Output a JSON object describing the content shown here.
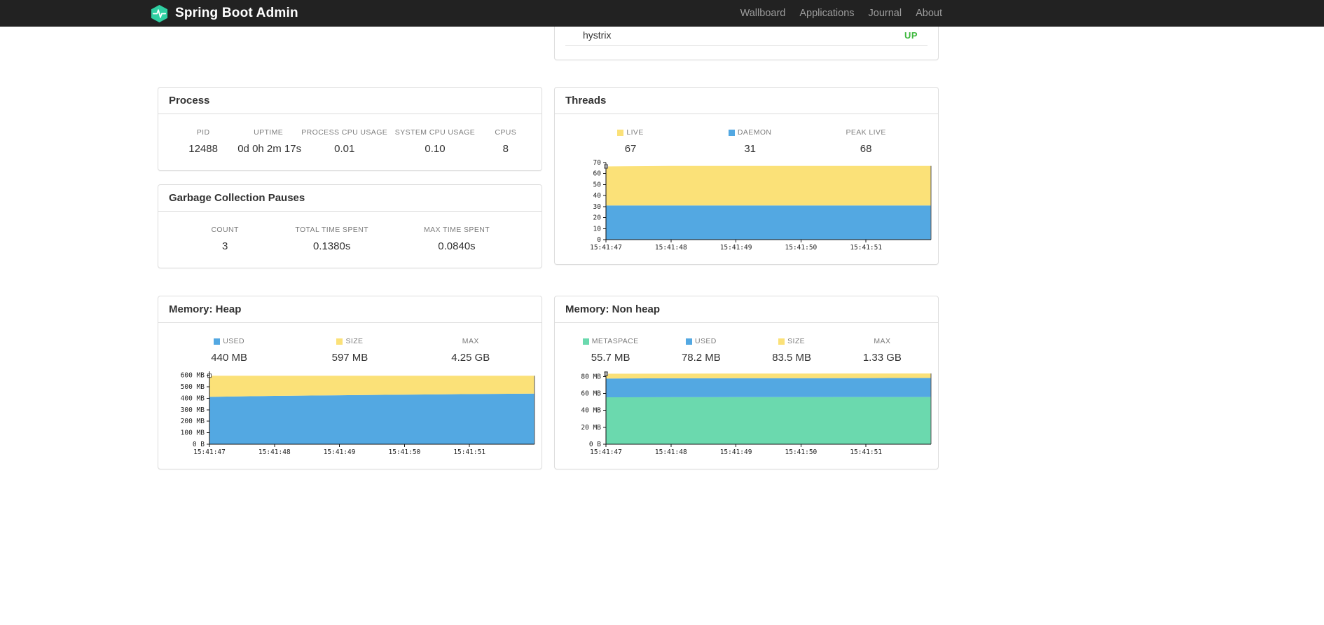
{
  "navbar": {
    "brand": "Spring Boot Admin",
    "items": [
      {
        "label": "Wallboard"
      },
      {
        "label": "Applications"
      },
      {
        "label": "Journal"
      },
      {
        "label": "About"
      }
    ]
  },
  "colors": {
    "navbar_bg": "#222222",
    "navbar_link": "#9D9D9D",
    "brand_teal": "#2FCFA2",
    "panel_border": "#DDDDDD",
    "status_up_green": "#3DB83D",
    "chart_yellow": "#FBE178",
    "chart_blue": "#53A8E2",
    "chart_green": "#6BD9AE"
  },
  "hystrix_panel": {
    "app_name": "hystrix",
    "status": "UP"
  },
  "process_panel": {
    "title": "Process",
    "metrics": [
      {
        "label": "PID",
        "value": "12488"
      },
      {
        "label": "UPTIME",
        "value": "0d 0h 2m 17s"
      },
      {
        "label": "PROCESS CPU USAGE",
        "value": "0.01"
      },
      {
        "label": "SYSTEM CPU USAGE",
        "value": "0.10"
      },
      {
        "label": "CPUS",
        "value": "8"
      }
    ]
  },
  "gc_panel": {
    "title": "Garbage Collection Pauses",
    "metrics": [
      {
        "label": "COUNT",
        "value": "3"
      },
      {
        "label": "TOTAL TIME SPENT",
        "value": "0.1380s"
      },
      {
        "label": "MAX TIME SPENT",
        "value": "0.0840s"
      }
    ]
  },
  "threads_panel": {
    "title": "Threads",
    "legend": [
      {
        "label": "LIVE",
        "value": "67",
        "color": "#FBE178"
      },
      {
        "label": "DAEMON",
        "value": "31",
        "color": "#53A8E2"
      },
      {
        "label": "PEAK LIVE",
        "value": "68",
        "color": null
      }
    ]
  },
  "heap_panel": {
    "title": "Memory: Heap",
    "legend": [
      {
        "label": "USED",
        "value": "440 MB",
        "color": "#53A8E2"
      },
      {
        "label": "SIZE",
        "value": "597 MB",
        "color": "#FBE178"
      },
      {
        "label": "MAX",
        "value": "4.25 GB",
        "color": null
      }
    ]
  },
  "nonheap_panel": {
    "title": "Memory: Non heap",
    "legend": [
      {
        "label": "METASPACE",
        "value": "55.7 MB",
        "color": "#6BD9AE"
      },
      {
        "label": "USED",
        "value": "78.2 MB",
        "color": "#53A8E2"
      },
      {
        "label": "SIZE",
        "value": "83.5 MB",
        "color": "#FBE178"
      },
      {
        "label": "MAX",
        "value": "1.33 GB",
        "color": null
      }
    ]
  },
  "chart_data": [
    {
      "id": "threads-chart",
      "type": "area",
      "title": "Threads",
      "unit": "threads",
      "x_labels": [
        "15:41:47",
        "15:41:48",
        "15:41:49",
        "15:41:50",
        "15:41:51"
      ],
      "ylim": [
        0,
        70
      ],
      "yticks": [
        {
          "v": 0,
          "label": "0"
        },
        {
          "v": 10,
          "label": "10"
        },
        {
          "v": 20,
          "label": "20"
        },
        {
          "v": 30,
          "label": "30"
        },
        {
          "v": 40,
          "label": "40"
        },
        {
          "v": 50,
          "label": "50"
        },
        {
          "v": 60,
          "label": "60"
        },
        {
          "v": 70,
          "label": "70"
        }
      ],
      "series": [
        {
          "name": "DAEMON",
          "color": "#53A8E2",
          "values": [
            31,
            31,
            31,
            31,
            31,
            31
          ]
        },
        {
          "name": "LIVE",
          "color": "#FBE178",
          "values": [
            66.5,
            67,
            67,
            67,
            67,
            67
          ]
        }
      ]
    },
    {
      "id": "heap-chart",
      "type": "area",
      "title": "Memory: Heap",
      "unit": "MB",
      "x_labels": [
        "15:41:47",
        "15:41:48",
        "15:41:49",
        "15:41:50",
        "15:41:51"
      ],
      "ylim": [
        0,
        635
      ],
      "yticks": [
        {
          "v": 0,
          "label": "0 B"
        },
        {
          "v": 100,
          "label": "100 MB"
        },
        {
          "v": 200,
          "label": "200 MB"
        },
        {
          "v": 300,
          "label": "300 MB"
        },
        {
          "v": 400,
          "label": "400 MB"
        },
        {
          "v": 500,
          "label": "500 MB"
        },
        {
          "v": 600,
          "label": "600 MB"
        }
      ],
      "series": [
        {
          "name": "USED",
          "color": "#53A8E2",
          "values": [
            413,
            421,
            427,
            432,
            437,
            441
          ]
        },
        {
          "name": "SIZE",
          "color": "#FBE178",
          "values": [
            597,
            597,
            597,
            597,
            597,
            597
          ]
        }
      ]
    },
    {
      "id": "nonheap-chart",
      "type": "area",
      "title": "Memory: Non heap",
      "unit": "MB",
      "x_labels": [
        "15:41:47",
        "15:41:48",
        "15:41:49",
        "15:41:50",
        "15:41:51"
      ],
      "ylim": [
        0,
        86
      ],
      "yticks": [
        {
          "v": 0,
          "label": "0 B"
        },
        {
          "v": 20,
          "label": "20 MB"
        },
        {
          "v": 40,
          "label": "40 MB"
        },
        {
          "v": 60,
          "label": "60 MB"
        },
        {
          "v": 80,
          "label": "80 MB"
        }
      ],
      "series": [
        {
          "name": "METASPACE",
          "color": "#6BD9AE",
          "values": [
            55.4,
            55.5,
            55.6,
            55.6,
            55.7,
            55.7
          ]
        },
        {
          "name": "USED",
          "color": "#53A8E2",
          "values": [
            77.6,
            77.8,
            77.9,
            78.0,
            78.1,
            78.2
          ]
        },
        {
          "name": "SIZE",
          "color": "#FBE178",
          "values": [
            83.2,
            83.3,
            83.4,
            83.4,
            83.5,
            83.5
          ]
        }
      ]
    }
  ]
}
